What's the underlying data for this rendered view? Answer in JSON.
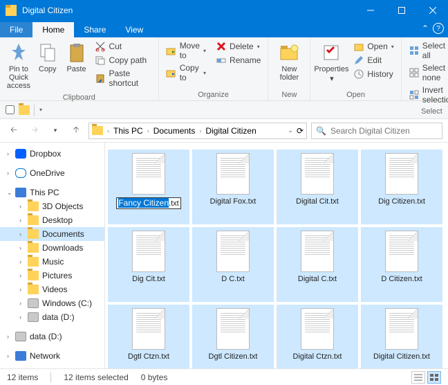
{
  "window": {
    "title": "Digital Citizen"
  },
  "tabs": {
    "file": "File",
    "home": "Home",
    "share": "Share",
    "view": "View"
  },
  "ribbon": {
    "clipboard": {
      "label": "Clipboard",
      "pin": "Pin to Quick\naccess",
      "copy": "Copy",
      "paste": "Paste",
      "cut": "Cut",
      "copypath": "Copy path",
      "pasteshortcut": "Paste shortcut"
    },
    "organize": {
      "label": "Organize",
      "moveto": "Move to",
      "copyto": "Copy to",
      "delete": "Delete",
      "rename": "Rename"
    },
    "new": {
      "label": "New",
      "newfolder": "New\nfolder"
    },
    "open": {
      "label": "Open",
      "properties": "Properties",
      "open": "Open",
      "edit": "Edit",
      "history": "History"
    },
    "select": {
      "label": "Select",
      "all": "Select all",
      "none": "Select none",
      "invert": "Invert selection"
    }
  },
  "breadcrumb": [
    "This PC",
    "Documents",
    "Digital Citizen"
  ],
  "search": {
    "placeholder": "Search Digital Citizen"
  },
  "tree": [
    {
      "label": "Dropbox",
      "icon": "db",
      "caret": ">"
    },
    {
      "spacer": true
    },
    {
      "label": "OneDrive",
      "icon": "od",
      "caret": ">"
    },
    {
      "spacer": true
    },
    {
      "label": "This PC",
      "icon": "pc",
      "caret": "v"
    },
    {
      "label": "3D Objects",
      "icon": "fold",
      "l2": true,
      "caret": ">"
    },
    {
      "label": "Desktop",
      "icon": "fold",
      "l2": true,
      "caret": ">"
    },
    {
      "label": "Documents",
      "icon": "fold",
      "l2": true,
      "caret": ">",
      "sel": true
    },
    {
      "label": "Downloads",
      "icon": "fold",
      "l2": true,
      "caret": ">"
    },
    {
      "label": "Music",
      "icon": "fold",
      "l2": true,
      "caret": ">"
    },
    {
      "label": "Pictures",
      "icon": "fold",
      "l2": true,
      "caret": ">"
    },
    {
      "label": "Videos",
      "icon": "fold",
      "l2": true,
      "caret": ">"
    },
    {
      "label": "Windows (C:)",
      "icon": "disk",
      "l2": true,
      "caret": ">"
    },
    {
      "label": "data (D:)",
      "icon": "disk",
      "l2": true,
      "caret": ">"
    },
    {
      "spacer": true
    },
    {
      "label": "data (D:)",
      "icon": "disk",
      "caret": ">"
    },
    {
      "spacer": true
    },
    {
      "label": "Network",
      "icon": "net",
      "caret": ">"
    }
  ],
  "files": [
    {
      "rename": true,
      "sel": "Fancy Citizen",
      "ext": ".txt"
    },
    {
      "name": "Digital Fox.txt"
    },
    {
      "name": "Digital Cit.txt"
    },
    {
      "name": "Dig Citizen.txt"
    },
    {
      "name": "Dig Cit.txt"
    },
    {
      "name": "D C.txt"
    },
    {
      "name": "Digital C.txt"
    },
    {
      "name": "D Citizen.txt"
    },
    {
      "name": "Dgtl Ctzn.txt"
    },
    {
      "name": "Dgtl Citizen.txt"
    },
    {
      "name": "Digital Ctzn.txt"
    },
    {
      "name": "Digital Citizen.txt"
    }
  ],
  "status": {
    "count": "12 items",
    "selected": "12 items selected",
    "size": "0 bytes"
  }
}
